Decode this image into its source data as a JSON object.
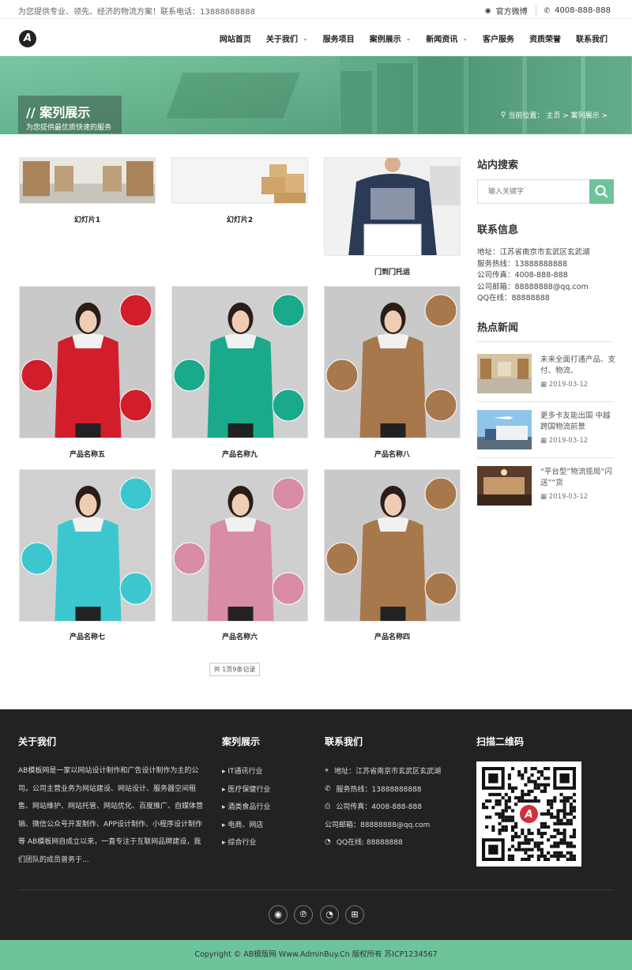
{
  "topbar": {
    "tagline": "为您提供专业、领先、经济的物流方案！联系电话：13888888888",
    "weibo": "官方微博",
    "phone": "4008-888-888"
  },
  "header": {
    "logo": "A",
    "nav": [
      {
        "label": "网站首页",
        "dropdown": false
      },
      {
        "label": "关于我们",
        "dropdown": true
      },
      {
        "label": "服务项目",
        "dropdown": false
      },
      {
        "label": "案例展示",
        "dropdown": true
      },
      {
        "label": "新闻资讯",
        "dropdown": true
      },
      {
        "label": "客户服务",
        "dropdown": false
      },
      {
        "label": "资质荣誉",
        "dropdown": false
      },
      {
        "label": "联系我们",
        "dropdown": false
      }
    ]
  },
  "banner": {
    "title": "// 案列展示",
    "subtitle": "为您提供最优质快速的服务",
    "crumb_prefix": "当前位置：",
    "crumb": "主页 > 案列展示 >"
  },
  "cases": [
    {
      "caption": "幻灯片1",
      "colors": [
        "#b7a07a",
        "#e9e9e9"
      ],
      "kind": "warehouse"
    },
    {
      "caption": "幻灯片2",
      "colors": [
        "#f2f2f2",
        "#d9b27c"
      ],
      "kind": "boxes"
    },
    {
      "caption": "门到门托运",
      "colors": [
        "#2b3a55",
        "#eeeeee"
      ],
      "kind": "courier"
    },
    {
      "caption": "产品名称五",
      "colors": [
        "#d21e2b",
        "#c9c9c9"
      ],
      "kind": "red"
    },
    {
      "caption": "产品名称九",
      "colors": [
        "#1aa98b",
        "#cfcfcf"
      ],
      "kind": "teal"
    },
    {
      "caption": "产品名称八",
      "colors": [
        "#a8784d",
        "#c9c9c9"
      ],
      "kind": "camel"
    },
    {
      "caption": "产品名称七",
      "colors": [
        "#3cc7cf",
        "#d0d0d0"
      ],
      "kind": "cyan"
    },
    {
      "caption": "产品名称六",
      "colors": [
        "#d88ca6",
        "#cfcfcf"
      ],
      "kind": "pink"
    },
    {
      "caption": "产品名称四",
      "colors": [
        "#a8784d",
        "#c9c9c9"
      ],
      "kind": "camel"
    }
  ],
  "pager": "共 1页9条记录",
  "sidebar": {
    "search_title": "站内搜索",
    "search_placeholder": "输入关键字",
    "contact_title": "联系信息",
    "contact": [
      "地址：江苏省南京市玄武区玄武湖",
      "服务热线：13888888888",
      "公司传真：4008-888-888",
      "公司邮箱：88888888@qq.com",
      "QQ在线：88888888"
    ],
    "news_title": "热点新闻",
    "news": [
      {
        "title": "未来全面打通产品、支付、物流、",
        "date": "2019-03-12"
      },
      {
        "title": "更多卡友能出国 中越跨国物流前景",
        "date": "2019-03-12"
      },
      {
        "title": "“平台型”物流揽局“闪送”“货",
        "date": "2019-03-12"
      }
    ]
  },
  "footer": {
    "about_title": "关于我们",
    "about_text": "AB模板网是一家以网站设计制作和广告设计制作为主的公司。公司主营业务为网站建设、网站设计、服务器空间租售、网站维护、网站托管、网站优化、百度推广、自媒体营销、微信公众号开发制作、APP设计制作、小程序设计制作等 AB模板网自成立以来，一直专注于互联网品牌建设，我们团队的成员曾务于...",
    "cases_title": "案列展示",
    "cases_links": [
      "IT通讯行业",
      "医疗保健行业",
      "酒类食品行业",
      "电商、网店",
      "综合行业"
    ],
    "contact_title": "联系我们",
    "contact": [
      {
        "icon": "map-icon",
        "text": "地址：江苏省南京市玄武区玄武湖"
      },
      {
        "icon": "phone-icon",
        "text": "服务热线：13888888888"
      },
      {
        "icon": "fax-icon",
        "text": "公司传真：4008-888-888"
      },
      {
        "icon": "",
        "text": "公司邮箱：88888888@qq.com"
      },
      {
        "icon": "qq-icon",
        "text": "QQ在线: 88888888"
      }
    ],
    "qr_title": "扫描二维码",
    "copyright": "Copyright © AB模版网 Www.AdminBuy.Cn 版权所有    苏ICP1234567"
  },
  "colors": {
    "accent": "#6dc39a",
    "footer_bg": "#222222"
  }
}
